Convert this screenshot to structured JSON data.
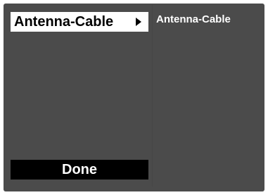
{
  "menu": {
    "selected_item_label": "Antenna-Cable",
    "arrow_icon": "triangle-right-icon"
  },
  "current_value": "Antenna-Cable",
  "done_button_label": "Done",
  "colors": {
    "panel_background": "#4b4b4b",
    "selected_item_background": "#ffffff",
    "selected_item_text": "#000000",
    "done_button_background": "#000000",
    "done_button_text": "#ffffff",
    "value_text": "#ffffff"
  }
}
